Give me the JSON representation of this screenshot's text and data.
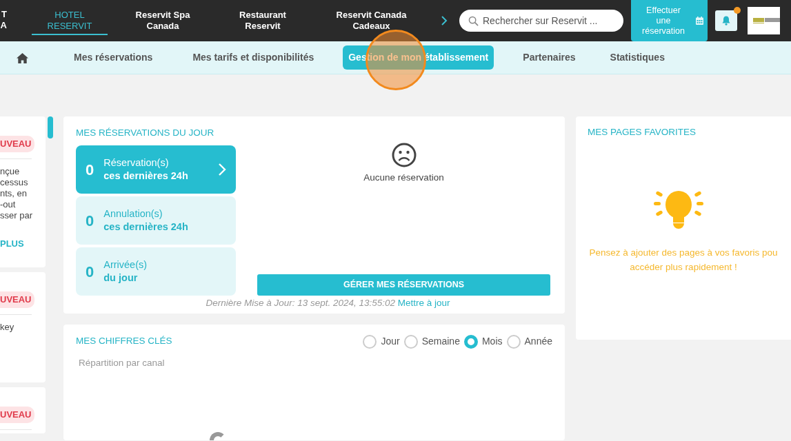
{
  "top_nav": {
    "tabs": [
      {
        "lines": [
          "T",
          "A"
        ],
        "selected": false
      },
      {
        "lines": [
          "HOTEL",
          "RESERVIT"
        ],
        "selected": true
      },
      {
        "lines": [
          "Reservit Spa",
          "Canada"
        ],
        "selected": false
      },
      {
        "lines": [
          "Restaurant",
          "Reservit"
        ],
        "selected": false
      },
      {
        "lines": [
          "Reservit Canada",
          "Cadeaux"
        ],
        "selected": false
      }
    ],
    "search": {
      "placeholder": "Rechercher sur Reservit ..."
    },
    "book_button": {
      "label": "Effectuer une réservation"
    },
    "notifications": {
      "unread": true
    }
  },
  "sub_nav": {
    "items": [
      {
        "kind": "home",
        "selected": false
      },
      {
        "kind": "text",
        "label": "Mes réservations",
        "selected": false
      },
      {
        "kind": "text",
        "label": "Mes tarifs et disponibilités",
        "selected": false
      },
      {
        "kind": "text",
        "label": "Gestion de mon établissement",
        "selected": true
      },
      {
        "kind": "text",
        "label": "Partenaires",
        "selected": false
      },
      {
        "kind": "text",
        "label": "Statistiques",
        "selected": false
      }
    ]
  },
  "side_cards": [
    {
      "badge": "UVEAU",
      "lines": [
        "nçue",
        "cessus",
        "nts, en",
        "-out",
        "sser par"
      ],
      "link": "PLUS"
    },
    {
      "badge": "UVEAU",
      "lines": [
        "key"
      ]
    },
    {
      "badge": "UVEAU"
    }
  ],
  "reservations_today": {
    "title": "MES RÉSERVATIONS DU JOUR",
    "stats": [
      {
        "count": "0",
        "label": "Réservation(s)",
        "sublabel": "ces dernières 24h",
        "selected": true
      },
      {
        "count": "0",
        "label": "Annulation(s)",
        "sublabel": "ces dernières 24h",
        "selected": false
      },
      {
        "count": "0",
        "label": "Arrivée(s)",
        "sublabel": "du jour",
        "selected": false
      }
    ],
    "empty_text": "Aucune réservation",
    "manage_button": "GÉRER MES RÉSERVATIONS",
    "last_update": "Dernière Mise à Jour: 13 sept. 2024, 13:55:02",
    "refresh_link": "Mettre à jour"
  },
  "key_figures": {
    "title": "MES CHIFFRES CLÉS",
    "periods": [
      {
        "label": "Jour",
        "selected": false
      },
      {
        "label": "Semaine",
        "selected": false
      },
      {
        "label": "Mois",
        "selected": true
      },
      {
        "label": "Année",
        "selected": false
      }
    ],
    "subtitle": "Répartition par canal"
  },
  "favorites": {
    "title": "MES PAGES FAVORITES",
    "hint": [
      "Pensez à ajouter des pages à vos favoris pou",
      "accéder plus rapidement !"
    ]
  }
}
